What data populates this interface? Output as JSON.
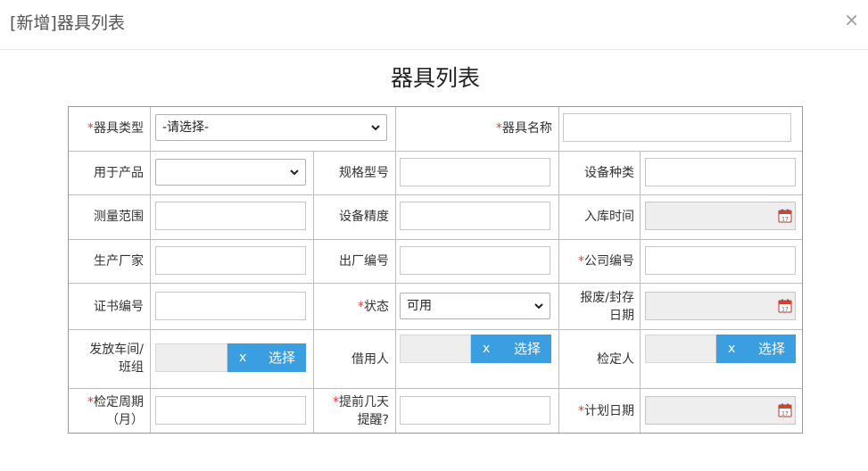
{
  "dialog": {
    "title": "[新增]器具列表",
    "close_label": "×"
  },
  "form": {
    "heading": "器具列表",
    "req_mark": "*",
    "labels": {
      "equip_type": "器具类型",
      "equip_name": "器具名称",
      "for_product": "用于产品",
      "spec_model": "规格型号",
      "equip_category": "设备种类",
      "measure_range": "测量范围",
      "equip_precision": "设备精度",
      "storage_time": "入库时间",
      "manufacturer": "生产厂家",
      "factory_no": "出厂编号",
      "company_no": "公司编号",
      "cert_no": "证书编号",
      "status": "状态",
      "scrap_date_1": "报废/封存",
      "scrap_date_2": "日期",
      "issue_workshop_1": "发放车间/",
      "issue_workshop_2": "班组",
      "borrower": "借用人",
      "inspector": "检定人",
      "period_1": "检定周期",
      "period_2": "（月）",
      "advance_1": "提前几天",
      "advance_2": "提醒?",
      "plan_date": "计划日期"
    },
    "values": {
      "equip_type_selected": "-请选择-",
      "for_product_selected": "",
      "status_selected": "可用"
    },
    "picker": {
      "clear_label": "x",
      "select_label": "选择"
    },
    "icons": {
      "dropdown": "chevron-down-icon",
      "calendar": "calendar-icon"
    },
    "colors": {
      "required": "#e53935",
      "picker_button": "#3b9ee0"
    }
  }
}
